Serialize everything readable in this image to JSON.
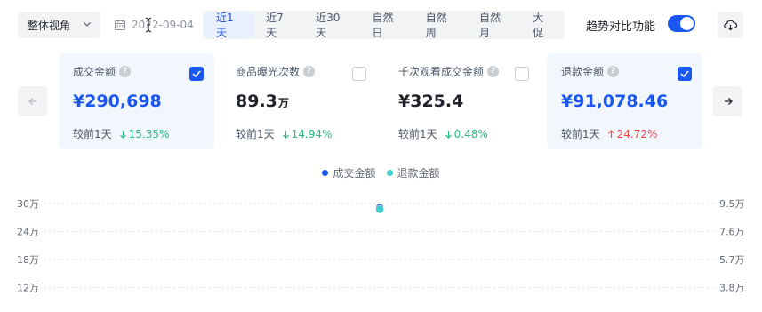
{
  "toolbar": {
    "view_select": "整体视角",
    "date_value": "2022-09-04",
    "date_prefix": "20",
    "date_suffix": "2-09-04",
    "range_tabs": [
      {
        "label": "近1天",
        "active": true
      },
      {
        "label": "近7天",
        "active": false
      },
      {
        "label": "近30天",
        "active": false
      },
      {
        "label": "自然日",
        "active": false
      },
      {
        "label": "自然周",
        "active": false
      },
      {
        "label": "自然月",
        "active": false
      },
      {
        "label": "大促",
        "active": false
      }
    ],
    "trend_compare_label": "趋势对比功能",
    "trend_compare_on": true
  },
  "metrics": [
    {
      "title": "成交金额",
      "value": "¥290,698",
      "unit": "",
      "checked": true,
      "compare_label": "较前1天",
      "delta": "15.35%",
      "direction": "down"
    },
    {
      "title": "商品曝光次数",
      "value": "89.3",
      "unit": "万",
      "checked": false,
      "compare_label": "较前1天",
      "delta": "14.94%",
      "direction": "down"
    },
    {
      "title": "千次观看成交金额",
      "value": "¥325.4",
      "unit": "",
      "checked": false,
      "compare_label": "较前1天",
      "delta": "0.48%",
      "direction": "down"
    },
    {
      "title": "退款金额",
      "value": "¥91,078.46",
      "unit": "",
      "checked": true,
      "compare_label": "较前1天",
      "delta": "24.72%",
      "direction": "up"
    }
  ],
  "colors": {
    "accent": "#1a56f0",
    "series_gmv": "#1a56f0",
    "series_refund": "#3fcfd0",
    "delta_down": "#2db87d",
    "delta_up": "#f5454b"
  },
  "chart_data": {
    "type": "scatter",
    "legend_position": "top-center",
    "series": [
      {
        "name": "成交金额",
        "axis": "left",
        "values": [
          290698
        ]
      },
      {
        "name": "退款金额",
        "axis": "right",
        "values": [
          91078.46
        ]
      }
    ],
    "y_left_ticks": [
      "30万",
      "24万",
      "18万",
      "12万"
    ],
    "y_left_values": [
      300000,
      240000,
      180000,
      120000
    ],
    "y_right_ticks": [
      "9.5万",
      "7.6万",
      "5.7万",
      "3.8万"
    ],
    "y_right_values": [
      95000,
      76000,
      57000,
      38000
    ],
    "grid": true
  }
}
